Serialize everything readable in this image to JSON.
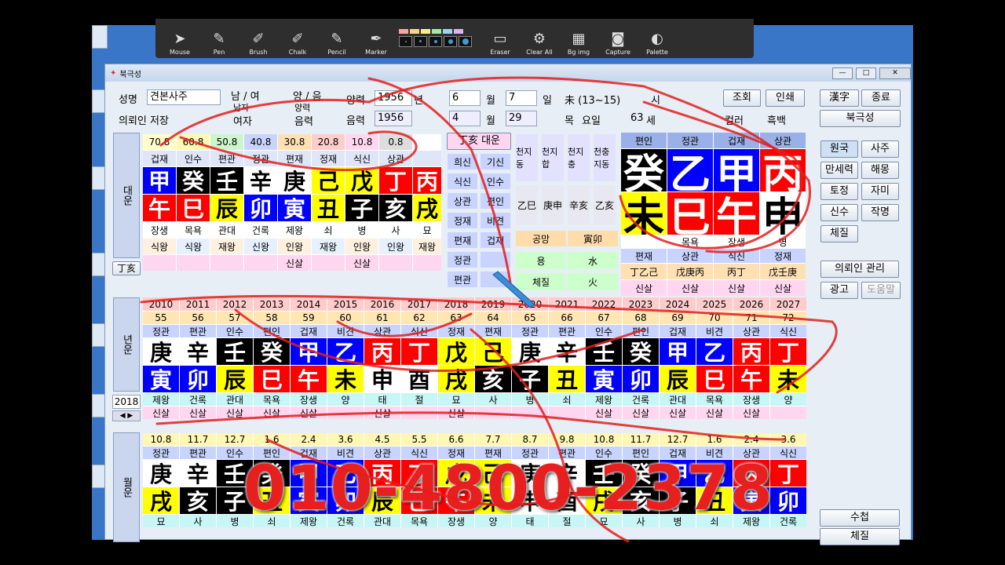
{
  "toolbar": [
    {
      "label": "Mouse",
      "icon": "mouse-cursor-icon"
    },
    {
      "label": "Pen",
      "icon": "pen-icon"
    },
    {
      "label": "Brush",
      "icon": "brush-icon"
    },
    {
      "label": "Chalk",
      "icon": "chalk-icon"
    },
    {
      "label": "Pencil",
      "icon": "pencil-icon"
    },
    {
      "label": "Marker",
      "icon": "marker-icon"
    },
    {
      "label": "Eraser",
      "icon": "eraser-icon"
    },
    {
      "label": "Clear All",
      "icon": "clear-all-icon"
    },
    {
      "label": "Bg img",
      "icon": "background-image-icon"
    },
    {
      "label": "Capture",
      "icon": "camera-icon"
    },
    {
      "label": "Palette",
      "icon": "palette-icon"
    }
  ],
  "palette_colors": [
    "#f4a6a6",
    "#f7d38c",
    "#f6f08a",
    "#a8e6a1",
    "#9fd4f0",
    "#d8b4f0"
  ],
  "window_title": "북극성",
  "form": {
    "name_label": "성명",
    "name_value": "견본사주",
    "gender_label": "남 / 여",
    "gender_male": "남자",
    "gender_female": "여자",
    "calendar_label": "양 / 음",
    "solar": "양력",
    "lunar": "음력",
    "solar_label": "양력",
    "solar_year": "1956",
    "year_unit": "년",
    "month": "6",
    "month_unit": "월",
    "day": "7",
    "day_unit": "일",
    "hour": "未 (13~15)",
    "hour_unit": "시",
    "lunar_label": "음력",
    "lunar_year": "1956",
    "lunar_month": "4",
    "lunar_day": "29",
    "weekday": "목",
    "weekday_label": "요일",
    "age": "63",
    "age_unit": "세",
    "client_label": "의뢰인 저장",
    "color_label": "컬러",
    "bw_label": "흑백"
  },
  "buttons": {
    "calc": "조회",
    "print": "인쇄",
    "hanja": "漢字",
    "exit": "종료",
    "app": "북극성",
    "side": [
      "원국",
      "사주",
      "만세력",
      "해몽",
      "토정",
      "자미",
      "신수",
      "작명",
      "체질"
    ],
    "client_mgmt": "의뢰인 관리",
    "ad": "광고",
    "help": "도움말",
    "bottom1": "수첩",
    "bottom2": "체질"
  },
  "daewoon": {
    "header": "대운",
    "toggle": "丁亥",
    "summary": "丁亥 대운",
    "ages": [
      "0.8",
      "10.8",
      "20.8",
      "30.8",
      "40.8",
      "50.8",
      "60.8",
      "70.8"
    ],
    "gods": [
      "상관",
      "식신",
      "정재",
      "편재",
      "정관",
      "편관",
      "인수",
      "겁재"
    ],
    "stems": [
      [
        "丙",
        "R"
      ],
      [
        "丁",
        "R"
      ],
      [
        "戊",
        "Y"
      ],
      [
        "己",
        "Y"
      ],
      [
        "庚",
        "W"
      ],
      [
        "辛",
        "W"
      ],
      [
        "壬",
        "K"
      ],
      [
        "癸",
        "K"
      ],
      [
        "甲",
        "B"
      ]
    ],
    "branches": [
      [
        "戌",
        "Y"
      ],
      [
        "亥",
        "K"
      ],
      [
        "子",
        "K"
      ],
      [
        "丑",
        "Y"
      ],
      [
        "寅",
        "B"
      ],
      [
        "卯",
        "B"
      ],
      [
        "辰",
        "Y"
      ],
      [
        "巳",
        "R"
      ],
      [
        "午",
        "R"
      ]
    ],
    "stage1": [
      "묘",
      "사",
      "병",
      "쇠",
      "제왕",
      "건록",
      "관대",
      "목욕",
      "장생"
    ],
    "stage2": [
      "재왕",
      "인왕",
      "인왕",
      "재왕",
      "인왕",
      "신왕",
      "재왕",
      "식왕",
      "식왕"
    ],
    "sinsal": [
      "신살",
      "신살"
    ]
  },
  "mid": {
    "gods": [
      [
        "희신",
        "기신"
      ],
      [
        "식신",
        "인수"
      ],
      [
        "상관",
        "편인"
      ],
      [
        "정재",
        "비견"
      ],
      [
        "편재",
        "겁재"
      ],
      [
        "정관",
        ""
      ],
      [
        "편관",
        ""
      ]
    ],
    "cols": [
      "천지동",
      "천지합",
      "천지충",
      "천충지동"
    ],
    "col_vals": [
      "乙巳",
      "庚申",
      "辛亥",
      "乙亥"
    ],
    "empty_label": "공망",
    "empty_val": "寅卯",
    "elem_rows": [
      [
        "용",
        "水"
      ],
      [
        "체질",
        "火"
      ]
    ]
  },
  "natal": {
    "headers": [
      "편인",
      "정관",
      "겁재",
      "상관"
    ],
    "stems": [
      [
        "癸",
        "K"
      ],
      [
        "乙",
        "B"
      ],
      [
        "甲",
        "B"
      ],
      [
        "丙",
        "R"
      ]
    ],
    "branches": [
      [
        "未",
        "Y"
      ],
      [
        "巳",
        "R"
      ],
      [
        "午",
        "R"
      ],
      [
        "申",
        "W"
      ]
    ],
    "stages": [
      "",
      "목욕",
      "장생",
      "병"
    ],
    "gods2": [
      "편재",
      "상관",
      "식신",
      "정재"
    ],
    "hidden": [
      "丁乙己",
      "戊庚丙",
      "丙丁",
      "戊壬庚"
    ],
    "sinsal": [
      "신살",
      "신살",
      "신살",
      "신살"
    ]
  },
  "yearly": {
    "header": "년운",
    "current": "2018",
    "years": [
      "2010",
      "2011",
      "2012",
      "2013",
      "2014",
      "2015",
      "2016",
      "2017",
      "2018",
      "2019",
      "2020",
      "2021",
      "2022",
      "2023",
      "2024",
      "2025",
      "2026",
      "2027"
    ],
    "ages": [
      "55",
      "56",
      "57",
      "58",
      "59",
      "60",
      "61",
      "62",
      "63",
      "64",
      "65",
      "66",
      "67",
      "68",
      "69",
      "70",
      "71",
      "72"
    ],
    "gods": [
      "정관",
      "편관",
      "인수",
      "편인",
      "겁재",
      "비견",
      "상관",
      "식신",
      "정재",
      "편재",
      "정관",
      "편관",
      "인수",
      "편인",
      "겁재",
      "비견",
      "상관",
      "식신"
    ],
    "stems": [
      [
        "庚",
        "W"
      ],
      [
        "辛",
        "W"
      ],
      [
        "壬",
        "K"
      ],
      [
        "癸",
        "K"
      ],
      [
        "甲",
        "B"
      ],
      [
        "乙",
        "B"
      ],
      [
        "丙",
        "R"
      ],
      [
        "丁",
        "R"
      ],
      [
        "戊",
        "Y"
      ],
      [
        "己",
        "Y"
      ],
      [
        "庚",
        "W"
      ],
      [
        "辛",
        "W"
      ],
      [
        "壬",
        "K"
      ],
      [
        "癸",
        "K"
      ],
      [
        "甲",
        "B"
      ],
      [
        "乙",
        "B"
      ],
      [
        "丙",
        "R"
      ],
      [
        "丁",
        "R"
      ]
    ],
    "branches": [
      [
        "寅",
        "B"
      ],
      [
        "卯",
        "B"
      ],
      [
        "辰",
        "Y"
      ],
      [
        "巳",
        "R"
      ],
      [
        "午",
        "R"
      ],
      [
        "未",
        "Y"
      ],
      [
        "申",
        "W"
      ],
      [
        "酉",
        "W"
      ],
      [
        "戌",
        "Y"
      ],
      [
        "亥",
        "K"
      ],
      [
        "子",
        "K"
      ],
      [
        "丑",
        "Y"
      ],
      [
        "寅",
        "B"
      ],
      [
        "卯",
        "B"
      ],
      [
        "辰",
        "Y"
      ],
      [
        "巳",
        "R"
      ],
      [
        "午",
        "R"
      ],
      [
        "未",
        "Y"
      ]
    ],
    "stages": [
      "제왕",
      "건록",
      "관대",
      "목욕",
      "장생",
      "양",
      "태",
      "절",
      "묘",
      "사",
      "병",
      "쇠",
      "제왕",
      "건록",
      "관대",
      "목욕",
      "장생",
      "양"
    ],
    "sinsal": [
      "신살",
      "신살",
      "신살",
      "신살",
      "신살",
      "",
      "신살",
      "",
      "신살",
      "",
      "",
      "",
      "신살",
      "신살",
      "신살",
      "신살",
      "신살",
      ""
    ]
  },
  "monthly": {
    "header": "월운",
    "dates": [
      "10.8",
      "11.7",
      "12.7",
      "1.6",
      "2.4",
      "3.6",
      "4.5",
      "5.5",
      "6.6",
      "7.7",
      "8.7",
      "9.8",
      "10.8",
      "11.7",
      "12.7",
      "1.6",
      "2.4",
      "3.6"
    ],
    "gods": [
      "정관",
      "편관",
      "인수",
      "편인",
      "겁재",
      "비견",
      "상관",
      "식신",
      "정재",
      "편재",
      "정관",
      "편관",
      "인수",
      "편인",
      "겁재",
      "비견",
      "상관",
      "식신"
    ],
    "stems": [
      [
        "庚",
        "W"
      ],
      [
        "辛",
        "W"
      ],
      [
        "壬",
        "K"
      ],
      [
        "癸",
        "K"
      ],
      [
        "甲",
        "B"
      ],
      [
        "乙",
        "B"
      ],
      [
        "丙",
        "R"
      ],
      [
        "丁",
        "R"
      ],
      [
        "戊",
        "Y"
      ],
      [
        "己",
        "Y"
      ],
      [
        "庚",
        "W"
      ],
      [
        "辛",
        "W"
      ],
      [
        "壬",
        "K"
      ],
      [
        "癸",
        "K"
      ],
      [
        "甲",
        "B"
      ],
      [
        "乙",
        "B"
      ],
      [
        "丙",
        "R"
      ],
      [
        "丁",
        "R"
      ]
    ],
    "branches": [
      [
        "戌",
        "Y"
      ],
      [
        "亥",
        "K"
      ],
      [
        "子",
        "K"
      ],
      [
        "丑",
        "Y"
      ],
      [
        "寅",
        "B"
      ],
      [
        "卯",
        "B"
      ],
      [
        "辰",
        "Y"
      ],
      [
        "巳",
        "R"
      ],
      [
        "午",
        "R"
      ],
      [
        "未",
        "Y"
      ],
      [
        "申",
        "W"
      ],
      [
        "酉",
        "W"
      ],
      [
        "戌",
        "Y"
      ],
      [
        "亥",
        "K"
      ],
      [
        "子",
        "K"
      ],
      [
        "丑",
        "Y"
      ],
      [
        "寅",
        "B"
      ],
      [
        "卯",
        "B"
      ]
    ],
    "stages": [
      "묘",
      "사",
      "병",
      "쇠",
      "제왕",
      "건록",
      "관대",
      "목욕",
      "장생",
      "양",
      "태",
      "절",
      "묘",
      "사",
      "병",
      "쇠",
      "제왕",
      "건록"
    ]
  },
  "overlay_phone": "010-4800-2378"
}
